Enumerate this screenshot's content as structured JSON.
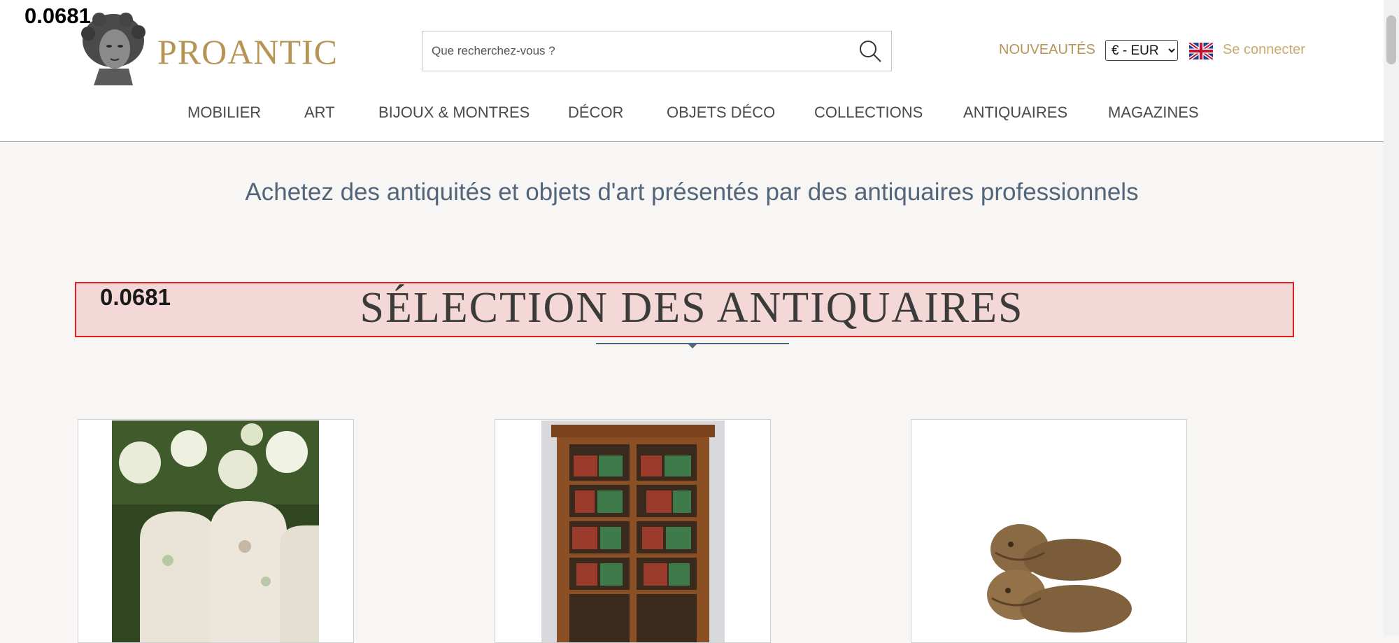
{
  "overlay": {
    "score_top": "0.0681",
    "score_box": "0.0681"
  },
  "header": {
    "brand": "PROANTIC",
    "search_placeholder": "Que recherchez-vous ?",
    "nouveautes": "NOUVEAUTÉS",
    "currency": {
      "selected": "€ - EUR"
    },
    "login": "Se connecter",
    "nav": [
      "MOBILIER",
      "ART",
      "BIJOUX & MONTRES",
      "DÉCOR",
      "OBJETS DÉCO",
      "COLLECTIONS",
      "ANTIQUAIRES",
      "MAGAZINES"
    ]
  },
  "main": {
    "tagline": "Achetez des antiquités et objets d'art présentés par des antiquaires professionnels",
    "section_title": "SÉLECTION DES ANTIQUAIRES"
  },
  "colors": {
    "brand_gold": "#b69554",
    "tagline_blue": "#52657a",
    "highlight_red": "#e02020"
  },
  "icons": [
    "bust-logo-icon",
    "search-icon",
    "uk-flag-icon",
    "chevron-down-icon"
  ]
}
